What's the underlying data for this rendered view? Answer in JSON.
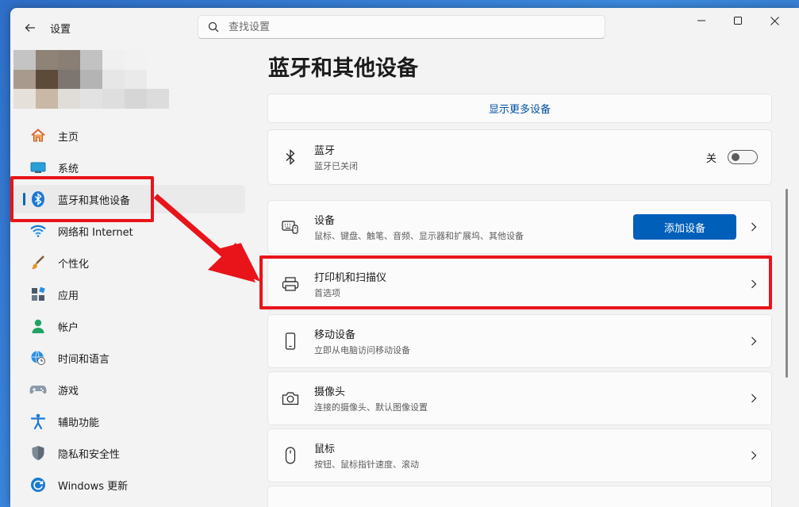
{
  "app": {
    "title": "设置"
  },
  "search": {
    "placeholder": "查找设置"
  },
  "avatar": {
    "colors": [
      "#c4c4c4",
      "#8f8378",
      "#8a7f74",
      "#c2c2c2",
      "#f0f0f0",
      "#f2f2f2",
      "#f3f3f3",
      "#a89a8c",
      "#5c4a3a",
      "#7d7570",
      "#b4b4b4",
      "#e6e6e6",
      "#eaeaea",
      "#f3f3f3",
      "#e6e0da",
      "#c9b8a6",
      "#e0dcd8",
      "#e2e2e2",
      "#dedede",
      "#d6d6d6",
      "#dcdcdc"
    ]
  },
  "sidebar": {
    "items": [
      {
        "label": "主页",
        "icon": "home-icon"
      },
      {
        "label": "系统",
        "icon": "monitor-icon"
      },
      {
        "label": "蓝牙和其他设备",
        "icon": "bluetooth-icon",
        "selected": true
      },
      {
        "label": "网络和 Internet",
        "icon": "wifi-icon"
      },
      {
        "label": "个性化",
        "icon": "brush-icon"
      },
      {
        "label": "应用",
        "icon": "apps-icon"
      },
      {
        "label": "帐户",
        "icon": "person-icon"
      },
      {
        "label": "时间和语言",
        "icon": "globe-clock-icon"
      },
      {
        "label": "游戏",
        "icon": "gamepad-icon"
      },
      {
        "label": "辅助功能",
        "icon": "accessibility-icon"
      },
      {
        "label": "隐私和安全性",
        "icon": "shield-icon"
      },
      {
        "label": "Windows 更新",
        "icon": "update-icon"
      }
    ]
  },
  "main": {
    "title": "蓝牙和其他设备",
    "show_more": "显示更多设备",
    "bluetooth": {
      "title": "蓝牙",
      "subtitle": "蓝牙已关闭",
      "toggle_label": "关",
      "toggle_on": false
    },
    "devices": {
      "title": "设备",
      "subtitle": "鼠标、键盘、触笔、音频、显示器和扩展坞、其他设备",
      "button": "添加设备"
    },
    "printers": {
      "title": "打印机和扫描仪",
      "subtitle": "首选项"
    },
    "mobile": {
      "title": "移动设备",
      "subtitle": "立即从电脑访问移动设备"
    },
    "camera": {
      "title": "摄像头",
      "subtitle": "连接的摄像头、默认图像设置"
    },
    "mouse": {
      "title": "鼠标",
      "subtitle": "按钮、鼠标指针速度、滚动"
    }
  },
  "colors": {
    "accent": "#005fb8",
    "highlight": "#e8141a"
  }
}
